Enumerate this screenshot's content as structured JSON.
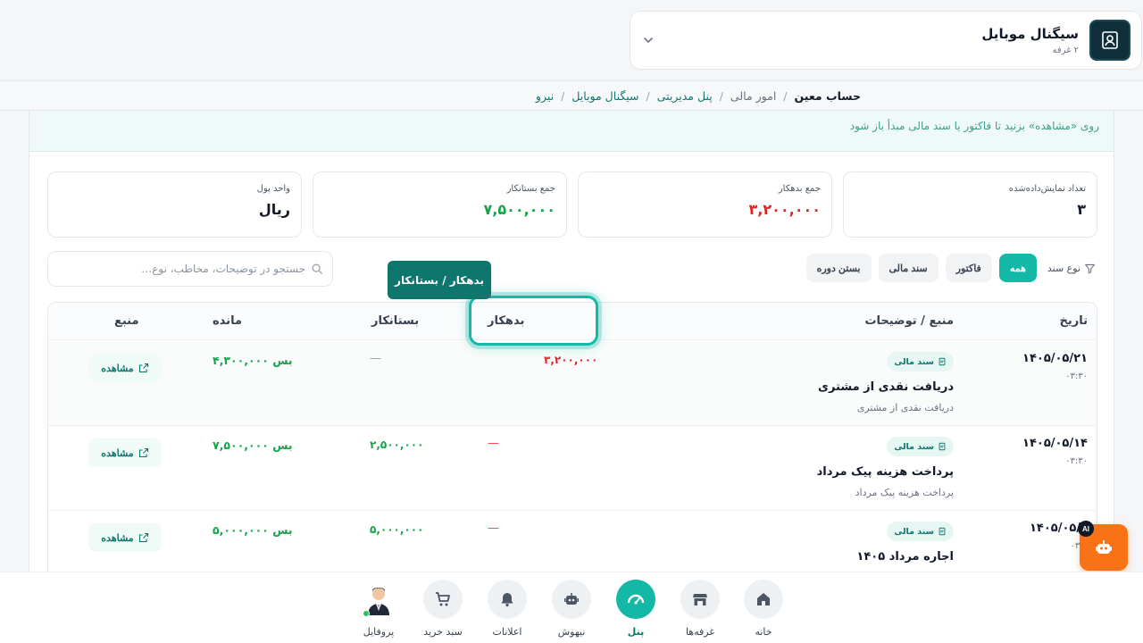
{
  "store": {
    "name": "سیگنال موبایل",
    "subtitle": "۲ غرفه"
  },
  "breadcrumb": {
    "items": [
      "نیرو",
      "سیگنال موبایل",
      "پنل مدیریتی",
      "امور مالی"
    ],
    "current": "حساب معین"
  },
  "hint": {
    "text": "روی «مشاهده» بزنید تا فاکتور یا سند مالی مبدأ باز شود"
  },
  "stats": [
    {
      "label": "تعداد نمایش‌داده‌شده",
      "value": "۳"
    },
    {
      "label": "جمع بدهکار",
      "value": "۳,۲۰۰,۰۰۰"
    },
    {
      "label": "جمع بستانکار",
      "value": "۷,۵۰۰,۰۰۰"
    },
    {
      "label": "واحد پول",
      "value": "ریال"
    }
  ],
  "filters": {
    "label": "نوع سند",
    "options": [
      "همه",
      "فاکتور",
      "سند مالی",
      "بستن دوره"
    ],
    "active": "همه"
  },
  "search": {
    "placeholder": "جستجو در توضیحات، مخاطب، نوع…"
  },
  "table": {
    "headers": {
      "date": "تاریخ",
      "source": "منبع / توضیحات",
      "debit": "بدهکار",
      "credit": "بستانکار",
      "balance": "مانده",
      "origin": "منبع"
    },
    "rows": [
      {
        "date": "۱۴۰۵/۰۵/۲۱",
        "time": "۰۳:۳۰",
        "badge": "سند مالی",
        "title": "دریافت نقدی از مشتری",
        "desc": "دریافت نقدی از مشتری",
        "debit": "۳,۲۰۰,۰۰۰",
        "credit": "—",
        "balance": "بس ۴,۳۰۰,۰۰۰",
        "action": "مشاهده"
      },
      {
        "date": "۱۴۰۵/۰۵/۱۴",
        "time": "۰۳:۳۰",
        "badge": "سند مالی",
        "title": "پرداخت هزینه پیک مرداد",
        "desc": "پرداخت هزینه پیک مرداد",
        "debit": "—",
        "credit": "۲,۵۰۰,۰۰۰",
        "balance": "بس ۷,۵۰۰,۰۰۰",
        "action": "مشاهده"
      },
      {
        "date": "۱۴۰۵/۰۵/۱",
        "time": "۰۳:۴",
        "badge": "سند مالی",
        "title": "اجاره مرداد ۱۴۰۵",
        "desc": "",
        "debit": "—",
        "credit": "۵,۰۰۰,۰۰۰",
        "balance": "بس ۵,۰۰۰,۰۰۰",
        "action": "مشاهده"
      }
    ]
  },
  "tooltip": {
    "text": "بدهکار / بستانکار"
  },
  "bottom_nav": [
    {
      "label": "خانه",
      "icon": "home-icon"
    },
    {
      "label": "غرفه‌ها",
      "icon": "store-icon"
    },
    {
      "label": "پنل",
      "icon": "dashboard-icon",
      "active": true
    },
    {
      "label": "نیهوش",
      "icon": "robot-icon"
    },
    {
      "label": "اعلانات",
      "icon": "bell-icon"
    },
    {
      "label": "سبد خرید",
      "icon": "cart-icon"
    },
    {
      "label": "پروفایل",
      "icon": "avatar"
    }
  ],
  "ai_fab": {
    "badge": "AI"
  },
  "colors": {
    "accent": "#14b8a6",
    "debit": "#dc2626",
    "credit": "#16a34a",
    "fab": "#f97316"
  }
}
